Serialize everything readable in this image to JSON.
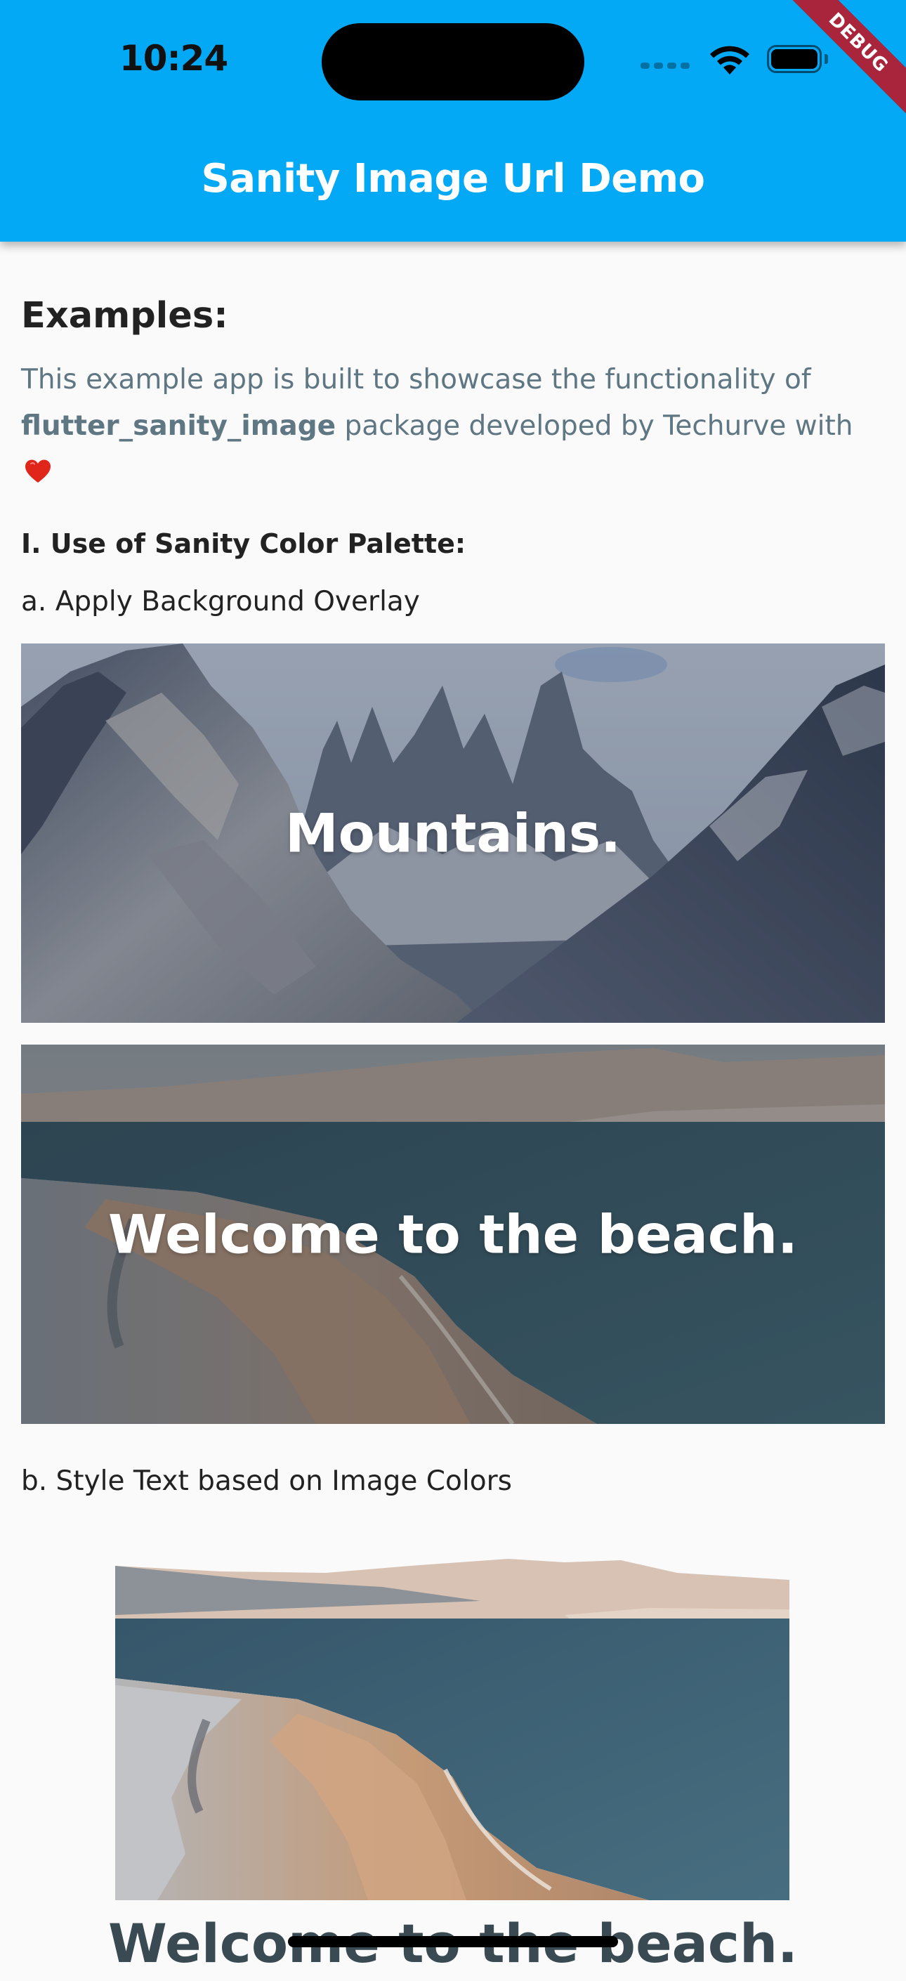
{
  "status_bar": {
    "time": "10:24"
  },
  "debug_banner": "DEBUG",
  "app_bar": {
    "title": "Sanity Image Url Demo"
  },
  "examples": {
    "title": "Examples:",
    "intro_prefix": "This example app is built to showcase the functionality of ",
    "package_name": "flutter_sanity_image",
    "intro_suffix": " package developed by Techurve with "
  },
  "section_one": {
    "title": "I. Use of Sanity Color Palette:",
    "a_label": "a. Apply Background Overlay",
    "cards": [
      {
        "overlay_text": "Mountains."
      },
      {
        "overlay_text": "Welcome to the beach."
      }
    ],
    "b_label": "b. Style Text based on Image Colors",
    "styled_caption": "Welcome to the beach."
  },
  "colors": {
    "app_bar": "#03A9F4",
    "background": "#FAFAFA",
    "intro_text": "#5F7683",
    "debug_ribbon": "#A8253B"
  },
  "icons": [
    "wifi-icon",
    "battery-icon",
    "heart-icon",
    "mountain-photo",
    "beach-photo"
  ]
}
